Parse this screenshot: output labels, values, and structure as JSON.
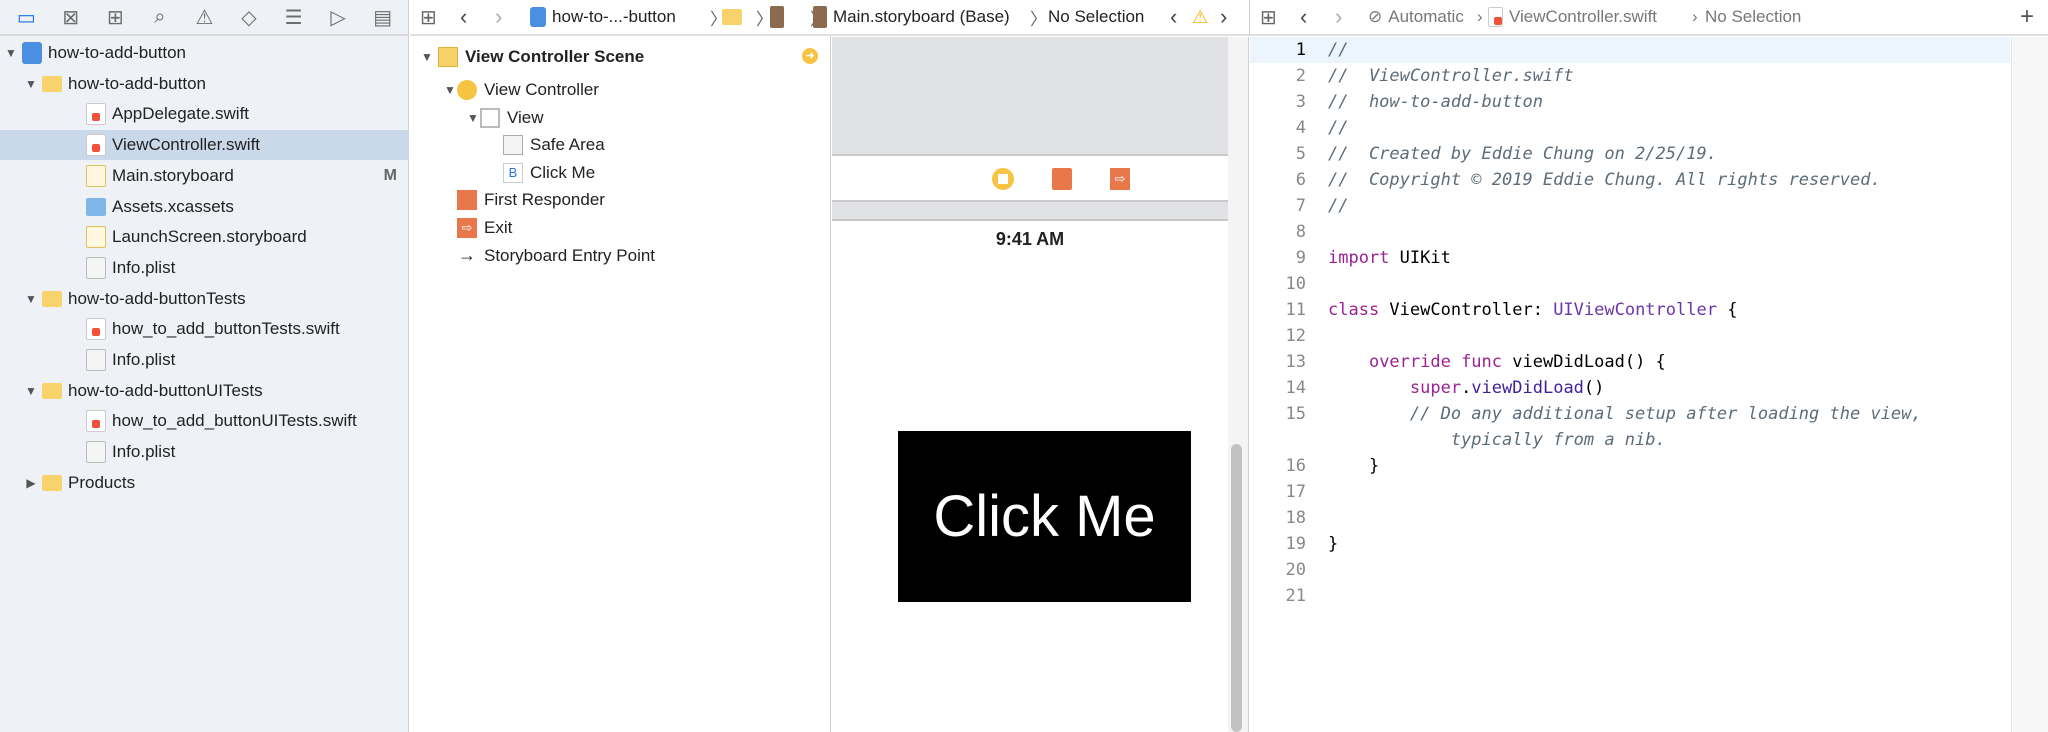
{
  "navigator_toolbar": {
    "icons": [
      "folder-icon",
      "source-control-icon",
      "hierarchy-icon",
      "search-icon",
      "warning-icon",
      "test-icon",
      "debug-icon",
      "breakpoint-icon",
      "report-icon"
    ]
  },
  "navigator": {
    "items": [
      {
        "label": "how-to-add-button",
        "kind": "project",
        "depth": 0,
        "expanded": true
      },
      {
        "label": "how-to-add-button",
        "kind": "folder",
        "depth": 1,
        "expanded": true
      },
      {
        "label": "AppDelegate.swift",
        "kind": "swift",
        "depth": 2
      },
      {
        "label": "ViewController.swift",
        "kind": "swift",
        "depth": 2,
        "selected": true
      },
      {
        "label": "Main.storyboard",
        "kind": "storyboard",
        "depth": 2,
        "badge": "M"
      },
      {
        "label": "Assets.xcassets",
        "kind": "assets",
        "depth": 2
      },
      {
        "label": "LaunchScreen.storyboard",
        "kind": "storyboard",
        "depth": 2
      },
      {
        "label": "Info.plist",
        "kind": "plist",
        "depth": 2
      },
      {
        "label": "how-to-add-buttonTests",
        "kind": "folder",
        "depth": 1,
        "expanded": true
      },
      {
        "label": "how_to_add_buttonTests.swift",
        "kind": "swift",
        "depth": 2
      },
      {
        "label": "Info.plist",
        "kind": "plist",
        "depth": 2
      },
      {
        "label": "how-to-add-buttonUITests",
        "kind": "folder",
        "depth": 1,
        "expanded": true
      },
      {
        "label": "how_to_add_buttonUITests.swift",
        "kind": "swift",
        "depth": 2
      },
      {
        "label": "Info.plist",
        "kind": "plist",
        "depth": 2
      },
      {
        "label": "Products",
        "kind": "folder",
        "depth": 1,
        "expanded": false
      }
    ]
  },
  "ib_jumpbar": {
    "project": "how-to-...-button",
    "file": "Main.storyboard (Base)",
    "selection": "No Selection"
  },
  "outline": {
    "scene": "View Controller Scene",
    "items": [
      {
        "label": "View Controller",
        "icon": "view-controller-icon",
        "depth": 1,
        "tri": "▼"
      },
      {
        "label": "View",
        "icon": "view-icon",
        "depth": 2,
        "tri": "▼"
      },
      {
        "label": "Safe Area",
        "icon": "safe-area-icon",
        "depth": 3
      },
      {
        "label": "Click Me",
        "icon": "button-icon",
        "depth": 3
      },
      {
        "label": "First Responder",
        "icon": "first-responder-icon",
        "depth": 1
      },
      {
        "label": "Exit",
        "icon": "exit-icon",
        "depth": 1
      },
      {
        "label": "Storyboard Entry Point",
        "icon": "arrow-right-icon",
        "depth": 1
      }
    ]
  },
  "canvas": {
    "status_time": "9:41 AM",
    "button_label": "Click Me",
    "button_bg": "#000000"
  },
  "editor_jumpbar": {
    "mode": "Automatic",
    "file": "ViewController.swift",
    "selection": "No Selection"
  },
  "code": {
    "current_line": 1,
    "lines": [
      {
        "n": "1",
        "tokens": [
          [
            "cm",
            "//"
          ]
        ]
      },
      {
        "n": "2",
        "tokens": [
          [
            "cm",
            "//  ViewController.swift"
          ]
        ]
      },
      {
        "n": "3",
        "tokens": [
          [
            "cm",
            "//  how-to-add-button"
          ]
        ]
      },
      {
        "n": "4",
        "tokens": [
          [
            "cm",
            "//"
          ]
        ]
      },
      {
        "n": "5",
        "tokens": [
          [
            "cm",
            "//  Created by Eddie Chung on 2/25/19."
          ]
        ]
      },
      {
        "n": "6",
        "tokens": [
          [
            "cm",
            "//  Copyright © 2019 Eddie Chung. All rights reserved."
          ]
        ]
      },
      {
        "n": "7",
        "tokens": [
          [
            "cm",
            "//"
          ]
        ]
      },
      {
        "n": "8",
        "tokens": []
      },
      {
        "n": "9",
        "tokens": [
          [
            "kw",
            "import"
          ],
          [
            "pl",
            " UIKit"
          ]
        ]
      },
      {
        "n": "10",
        "tokens": []
      },
      {
        "n": "11",
        "tokens": [
          [
            "kw",
            "class"
          ],
          [
            "pl",
            " ViewController: "
          ],
          [
            "ty",
            "UIViewController"
          ],
          [
            "pl",
            " {"
          ]
        ]
      },
      {
        "n": "12",
        "tokens": []
      },
      {
        "n": "13",
        "tokens": [
          [
            "pl",
            "    "
          ],
          [
            "kw",
            "override func"
          ],
          [
            "pl",
            " viewDidLoad() {"
          ]
        ]
      },
      {
        "n": "14",
        "tokens": [
          [
            "pl",
            "        "
          ],
          [
            "kw",
            "super"
          ],
          [
            "pl",
            "."
          ],
          [
            "fn",
            "viewDidLoad"
          ],
          [
            "pl",
            "()"
          ]
        ]
      },
      {
        "n": "15",
        "tokens": [
          [
            "cm",
            "        // Do any additional setup after loading the view,"
          ]
        ]
      },
      {
        "n": "",
        "tokens": [
          [
            "cm",
            "            typically from a nib."
          ]
        ]
      },
      {
        "n": "16",
        "tokens": [
          [
            "pl",
            "    }"
          ]
        ]
      },
      {
        "n": "17",
        "tokens": []
      },
      {
        "n": "18",
        "tokens": []
      },
      {
        "n": "19",
        "tokens": [
          [
            "pl",
            "}"
          ]
        ]
      },
      {
        "n": "20",
        "tokens": []
      },
      {
        "n": "21",
        "tokens": []
      }
    ]
  }
}
